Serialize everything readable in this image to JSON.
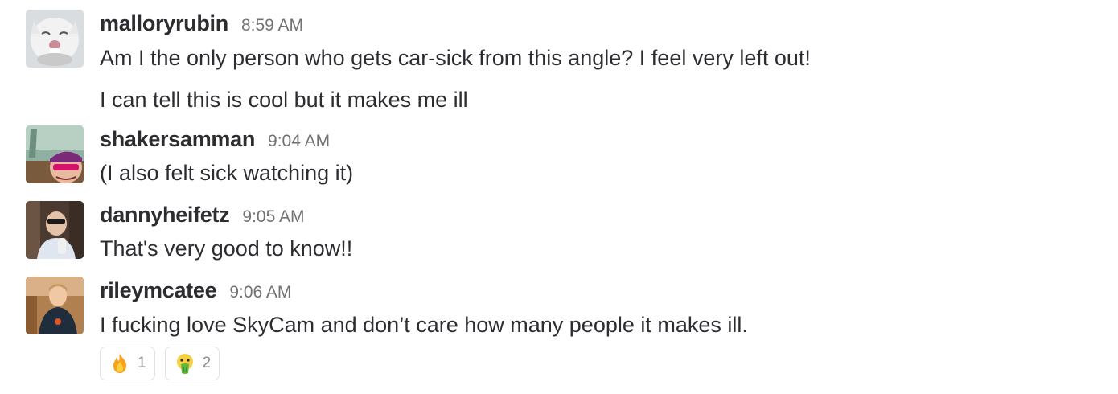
{
  "messages": [
    {
      "username": "malloryrubin",
      "time": "8:59 AM",
      "lines": [
        "Am I the only person who gets car-sick from this angle? I feel very left out!",
        "I can tell this is cool but it makes me ill"
      ]
    },
    {
      "username": "shakersamman",
      "time": "9:04 AM",
      "lines": [
        "(I also felt sick watching it)"
      ]
    },
    {
      "username": "dannyheifetz",
      "time": "9:05 AM",
      "lines": [
        "That's very good to know!!"
      ]
    },
    {
      "username": "rileymcatee",
      "time": "9:06 AM",
      "lines": [
        "I fucking love SkyCam and don’t care how many people it makes ill."
      ],
      "reactions": [
        {
          "emoji": "fire-icon",
          "count": "1"
        },
        {
          "emoji": "nauseated-face-icon",
          "count": "2"
        }
      ]
    }
  ],
  "colors": {
    "text": "#2c2d30",
    "timestamp": "#717274",
    "reaction_border": "#e3e3e3",
    "reaction_count": "#8a8b8d"
  }
}
